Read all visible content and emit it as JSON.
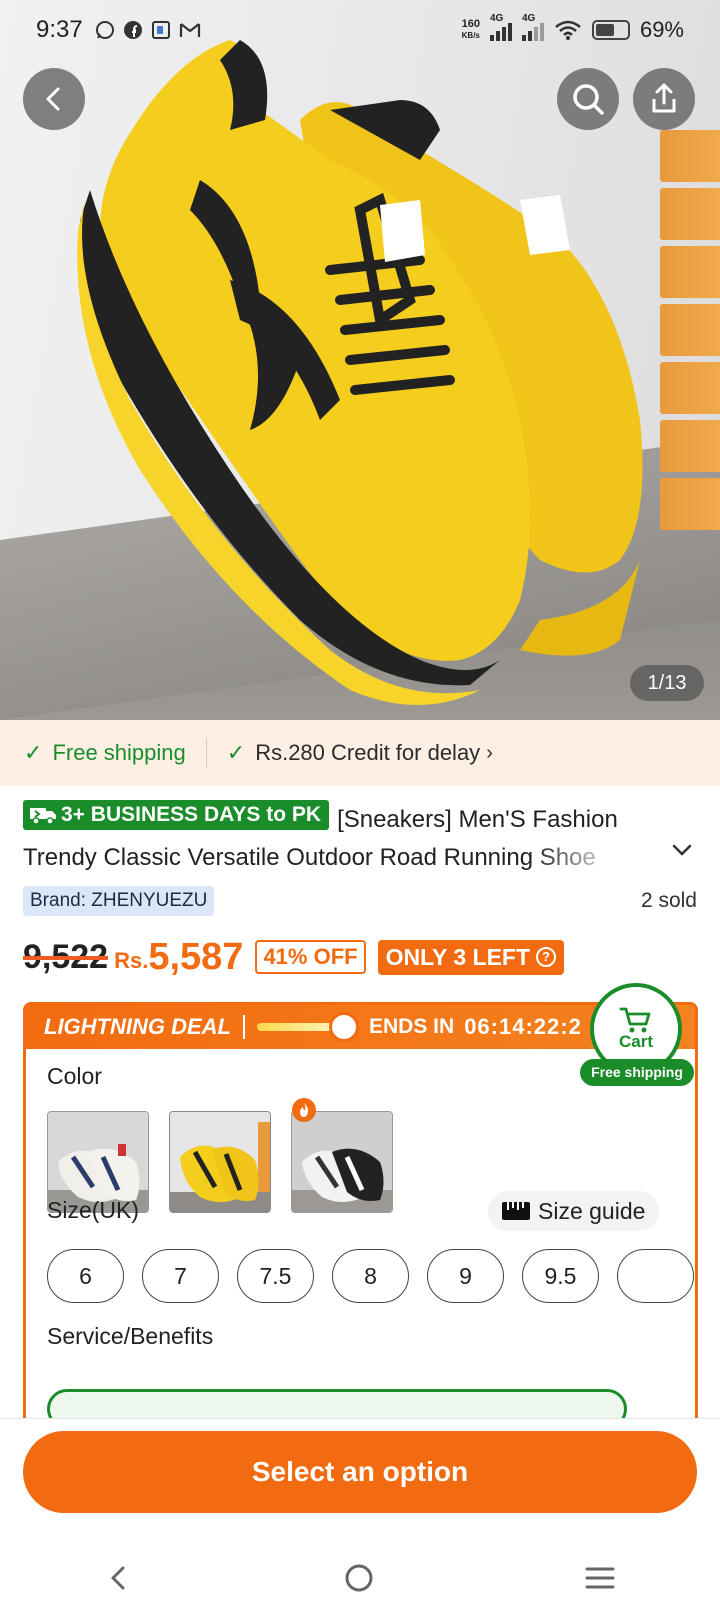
{
  "status_bar": {
    "time": "9:37",
    "net_speed_value": "160",
    "net_speed_unit": "KB/s",
    "signal_1_label": "4G",
    "signal_2_label": "4G",
    "battery": "69%"
  },
  "gallery": {
    "counter": "1/13"
  },
  "shipping_banner": {
    "free_shipping": "Free shipping",
    "credit": "Rs.280 Credit for delay"
  },
  "product": {
    "delivery_badge": "3+ BUSINESS DAYS to PK",
    "title_line1": "[Sneakers] Men'S Fashion",
    "title_line2": "Trendy Classic Versatile Outdoor Road Running Shoe",
    "brand": "Brand: ZHENYUEZU",
    "sold": "2 sold",
    "original_price": "9,522",
    "currency": "Rs.",
    "price": "5,587",
    "discount": "41% OFF",
    "stock": "ONLY 3 LEFT"
  },
  "deal": {
    "title": "LIGHTNING DEAL",
    "ends_label": "ENDS IN",
    "countdown": "06:14:22:2"
  },
  "options": {
    "color_label": "Color",
    "size_label": "Size(UK)",
    "size_guide": "Size guide",
    "sizes": [
      "6",
      "7",
      "7.5",
      "8",
      "9",
      "9.5",
      ""
    ],
    "service_label": "Service/Benefits"
  },
  "cart": {
    "label": "Cart",
    "free_shipping": "Free shipping"
  },
  "actions": {
    "select_option": "Select an option"
  },
  "colors": {
    "accent": "#f26b10",
    "green": "#1a8d2a",
    "banner_bg": "#fdefe4"
  }
}
